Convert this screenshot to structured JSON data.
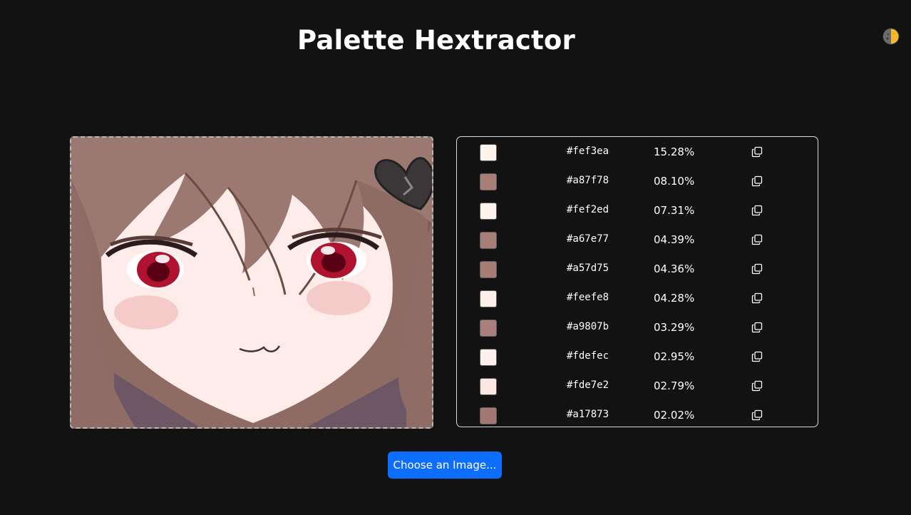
{
  "header": {
    "title": "Palette Hextractor",
    "theme_toggle_icon": "half-moon-theme-icon"
  },
  "image_preview": {
    "subject": "anime-girl-face"
  },
  "palette": [
    {
      "hex": "#fef3ea",
      "percent": "15.28%"
    },
    {
      "hex": "#a87f78",
      "percent": "08.10%"
    },
    {
      "hex": "#fef2ed",
      "percent": "07.31%"
    },
    {
      "hex": "#a67e77",
      "percent": "04.39%"
    },
    {
      "hex": "#a57d75",
      "percent": "04.36%"
    },
    {
      "hex": "#feefe8",
      "percent": "04.28%"
    },
    {
      "hex": "#a9807b",
      "percent": "03.29%"
    },
    {
      "hex": "#fdefec",
      "percent": "02.95%"
    },
    {
      "hex": "#fde7e2",
      "percent": "02.79%"
    },
    {
      "hex": "#a17873",
      "percent": "02.02%"
    }
  ],
  "copy_icon": "copy-icon",
  "actions": {
    "choose_label": "Choose an Image..."
  },
  "colors": {
    "background": "#121212",
    "accent": "#0d6efd",
    "text": "#ffffff",
    "toggle_yellow": "#f5b82e"
  }
}
